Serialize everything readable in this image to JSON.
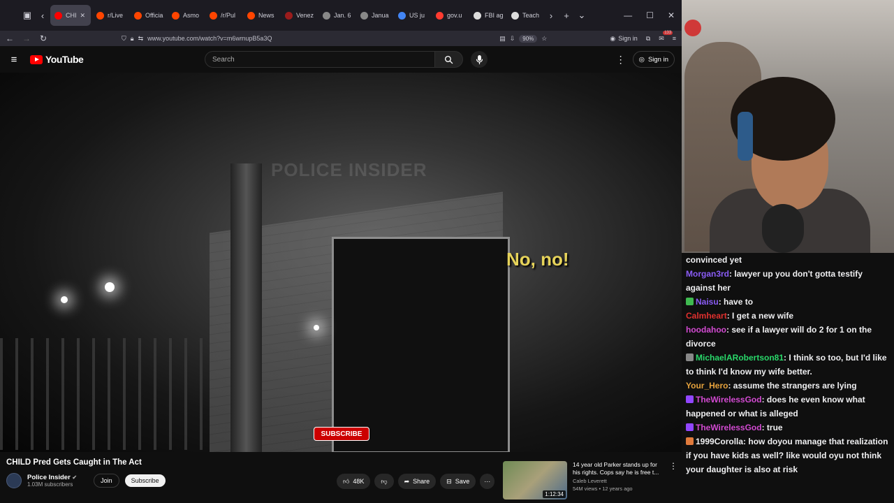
{
  "browser": {
    "tabs": [
      {
        "label": "CHI",
        "color": "#ff0000",
        "active": true
      },
      {
        "label": "r/Live",
        "color": "#ff4500"
      },
      {
        "label": "Officia",
        "color": "#ff4500"
      },
      {
        "label": "Asmo",
        "color": "#ff4500"
      },
      {
        "label": "/r/Pul",
        "color": "#ff4500"
      },
      {
        "label": "News",
        "color": "#ff4500"
      },
      {
        "label": "Venez",
        "color": "#9b1c1c"
      },
      {
        "label": "Jan. 6",
        "color": "#888888"
      },
      {
        "label": "Janua",
        "color": "#888888"
      },
      {
        "label": "US ju",
        "color": "#4285f4"
      },
      {
        "label": "gov.u",
        "color": "#ff3b30"
      },
      {
        "label": "FBI ag",
        "color": "#dddddd"
      },
      {
        "label": "Teach",
        "color": "#dddddd"
      }
    ],
    "url": "www.youtube.com/watch?v=m6wmupB5a3Q",
    "zoom": "90%",
    "signin_label": "Sign in",
    "notif_count": "133"
  },
  "youtube": {
    "brand": "YouTube",
    "search_placeholder": "Search",
    "signin_label": "Sign in"
  },
  "video": {
    "watermark": "POLICE INSIDER",
    "subtitle": "No, no!",
    "subscribe_overlay": "SUBSCRIBE",
    "title": "CHILD Pred Gets Caught in The Act",
    "channel": "Police Insider",
    "subscribers": "1.03M subscribers",
    "join_label": "Join",
    "subscribe_label": "Subscribe",
    "likes": "48K",
    "share_label": "Share",
    "save_label": "Save"
  },
  "recommended": {
    "title": "14 year old Parker stands up for his rights. Cops say he is free t...",
    "channel": "Caleb Leverett",
    "meta": "54M views • 12 years ago",
    "duration": "1:12:34"
  },
  "chat": [
    {
      "user": "",
      "text": "convinced yet",
      "color": "#efeff1"
    },
    {
      "user": "Morgan3rd",
      "text": ": lawyer up you don't gotta testify against her",
      "color": "#8a5cf5"
    },
    {
      "user": "Naisu",
      "text": ": have to",
      "color": "#8a5cf5",
      "badge": "#3fb950"
    },
    {
      "user": "Calmheart",
      "text": ": I get a new wife",
      "color": "#e0302e"
    },
    {
      "user": "hoodahoo",
      "text": ": see if a lawyer will do 2 for 1 on the divorce",
      "color": "#d24ad1"
    },
    {
      "user": "MichaelARobertson81",
      "text": ": I think so too, but I'd like to think I'd know my wife better.",
      "color": "#29d86a",
      "badge": "#888888"
    },
    {
      "user": "Your_Hero",
      "text": ": assume the strangers are lying",
      "color": "#e6a23c"
    },
    {
      "user": "TheWirelessGod",
      "text": ": does he even know what happened or what is alleged",
      "color": "#d24ad1",
      "badge": "#9146ff"
    },
    {
      "user": "TheWirelessGod",
      "text": ": true",
      "color": "#d24ad1",
      "badge": "#9146ff"
    },
    {
      "user": "1999Corolla",
      "text": ": how doyou manage that realization if you have kids as well? like would oyu not think your daughter is also at risk",
      "color": "#efeff1",
      "badge": "#e07a3c"
    }
  ]
}
